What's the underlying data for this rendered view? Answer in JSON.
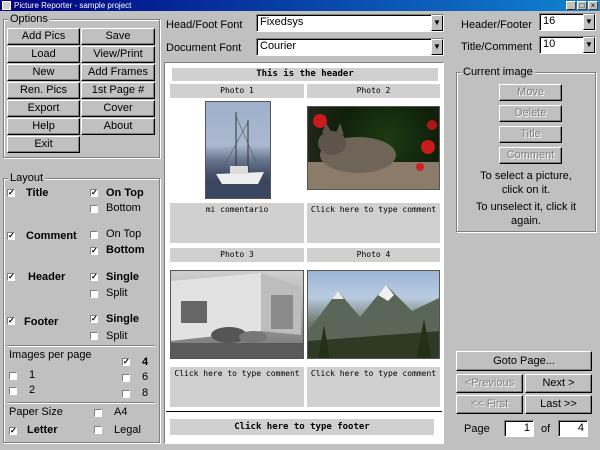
{
  "window": {
    "title": "Picture Reporter - sample project"
  },
  "options": {
    "title": "Options",
    "buttons": [
      "Add Pics",
      "Save",
      "Load",
      "View/Print",
      "New",
      "Add Frames",
      "Ren. Pics",
      "1st Page #",
      "Export",
      "Cover",
      "Help",
      "About",
      "Exit"
    ]
  },
  "fonts": {
    "head_foot_label": "Head/Foot Font",
    "head_foot_value": "Fixedsys",
    "document_label": "Document Font",
    "document_value": "Courier"
  },
  "sizes": {
    "header_footer_label": "Header/Footer",
    "header_footer_value": "16",
    "title_comment_label": "Title/Comment",
    "title_comment_value": "10"
  },
  "layout": {
    "title": "Layout",
    "title_label": "Title",
    "title_on_top": "On Top",
    "title_bottom": "Bottom",
    "comment_label": "Comment",
    "comment_on_top": "On Top",
    "comment_bottom": "Bottom",
    "header_label": "Header",
    "header_single": "Single",
    "header_split": "Split",
    "footer_label": "Footer",
    "footer_single": "Single",
    "footer_split": "Split",
    "images_per_page_label": "Images per page",
    "ipp_1": "1",
    "ipp_2": "2",
    "ipp_4": "4",
    "ipp_6": "6",
    "ipp_8": "8",
    "paper_size_label": "Paper Size",
    "paper_a4": "A4",
    "paper_letter": "Letter",
    "paper_legal": "Legal"
  },
  "checks": {
    "title": true,
    "title_on_top": true,
    "title_bottom": false,
    "comment": true,
    "comment_on_top": false,
    "comment_bottom": true,
    "header": true,
    "header_single": true,
    "header_split": false,
    "footer": true,
    "footer_single": true,
    "footer_split": false,
    "ipp_1": false,
    "ipp_2": false,
    "ipp_4": true,
    "ipp_6": false,
    "ipp_8": false,
    "paper_a4": false,
    "paper_letter": true,
    "paper_legal": false
  },
  "preview": {
    "header": "This is the header",
    "footer": "Click here to type footer",
    "photos": [
      {
        "title": "Photo 1",
        "comment": "mi comentario"
      },
      {
        "title": "Photo 2",
        "comment": "Click here to type comment"
      },
      {
        "title": "Photo 3",
        "comment": "Click here to type comment"
      },
      {
        "title": "Photo 4",
        "comment": "Click here to type comment"
      }
    ]
  },
  "current_image": {
    "title": "Current image",
    "move": "Move",
    "delete": "Delete",
    "title_btn": "Title",
    "comment_btn": "Comment",
    "instr_select": "To select a picture, click on it.",
    "instr_unselect": "To unselect it, click it again."
  },
  "nav": {
    "goto_page": "Goto Page...",
    "previous": "<Previous",
    "next": "Next >",
    "first": "<< First",
    "last": "Last >>",
    "page_label": "Page",
    "of_label": "of",
    "page_value": "1",
    "page_total": "4"
  }
}
